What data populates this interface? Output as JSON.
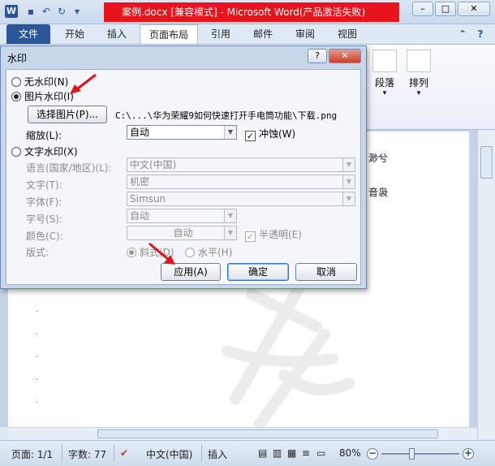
{
  "window": {
    "title": "案例.docx [兼容模式] - Microsoft Word(产品激活失败)",
    "app_icon": "W",
    "controls": {
      "minimize": "–",
      "maximize": "□",
      "close": "✕"
    }
  },
  "ribbon": {
    "tabs": [
      "文件",
      "开始",
      "插入",
      "页面布局",
      "引用",
      "邮件",
      "审阅",
      "视图"
    ],
    "active_tab": "页面布局",
    "groups": {
      "paragraph": "段落",
      "arrange": "排列"
    }
  },
  "document": {
    "text_fragments": [
      "渺兮",
      "音袅"
    ],
    "paragraph_mark": "."
  },
  "dialog": {
    "title": "水印",
    "help": "?",
    "close": "✕",
    "options": {
      "no_watermark": "无水印(N)",
      "picture_watermark": "图片水印(I)",
      "text_watermark": "文字水印(X)"
    },
    "picture": {
      "select_button": "选择图片(P)...",
      "path": "C:\\...\\华为荣耀9如何快速打开手电筒功能\\下载.png",
      "scale_label": "缩放(L):",
      "scale_value": "自动",
      "washout_label": "冲蚀(W)",
      "washout_checked": true
    },
    "text": {
      "language_label": "语言(国家/地区)(L):",
      "language_value": "中文(中国)",
      "text_label": "文字(T):",
      "text_value": "机密",
      "font_label": "字体(F):",
      "font_value": "Simsun",
      "size_label": "字号(S):",
      "size_value": "自动",
      "color_label": "颜色(C):",
      "color_value": "自动",
      "semitransparent_label": "半透明(E)",
      "layout_label": "版式:",
      "diagonal_label": "斜式(D)",
      "horizontal_label": "水平(H)"
    },
    "buttons": {
      "apply": "应用(A)",
      "ok": "确定",
      "cancel": "取消"
    }
  },
  "statusbar": {
    "page": "页面: 1/1",
    "words": "字数: 77",
    "language": "中文(中国)",
    "mode": "插入",
    "zoom": "80%",
    "zoom_out": "−",
    "zoom_in": "+"
  },
  "colors": {
    "title_highlight": "#e8141b",
    "file_tab": "#2b579a",
    "annotation_arrow": "#e0141b"
  }
}
